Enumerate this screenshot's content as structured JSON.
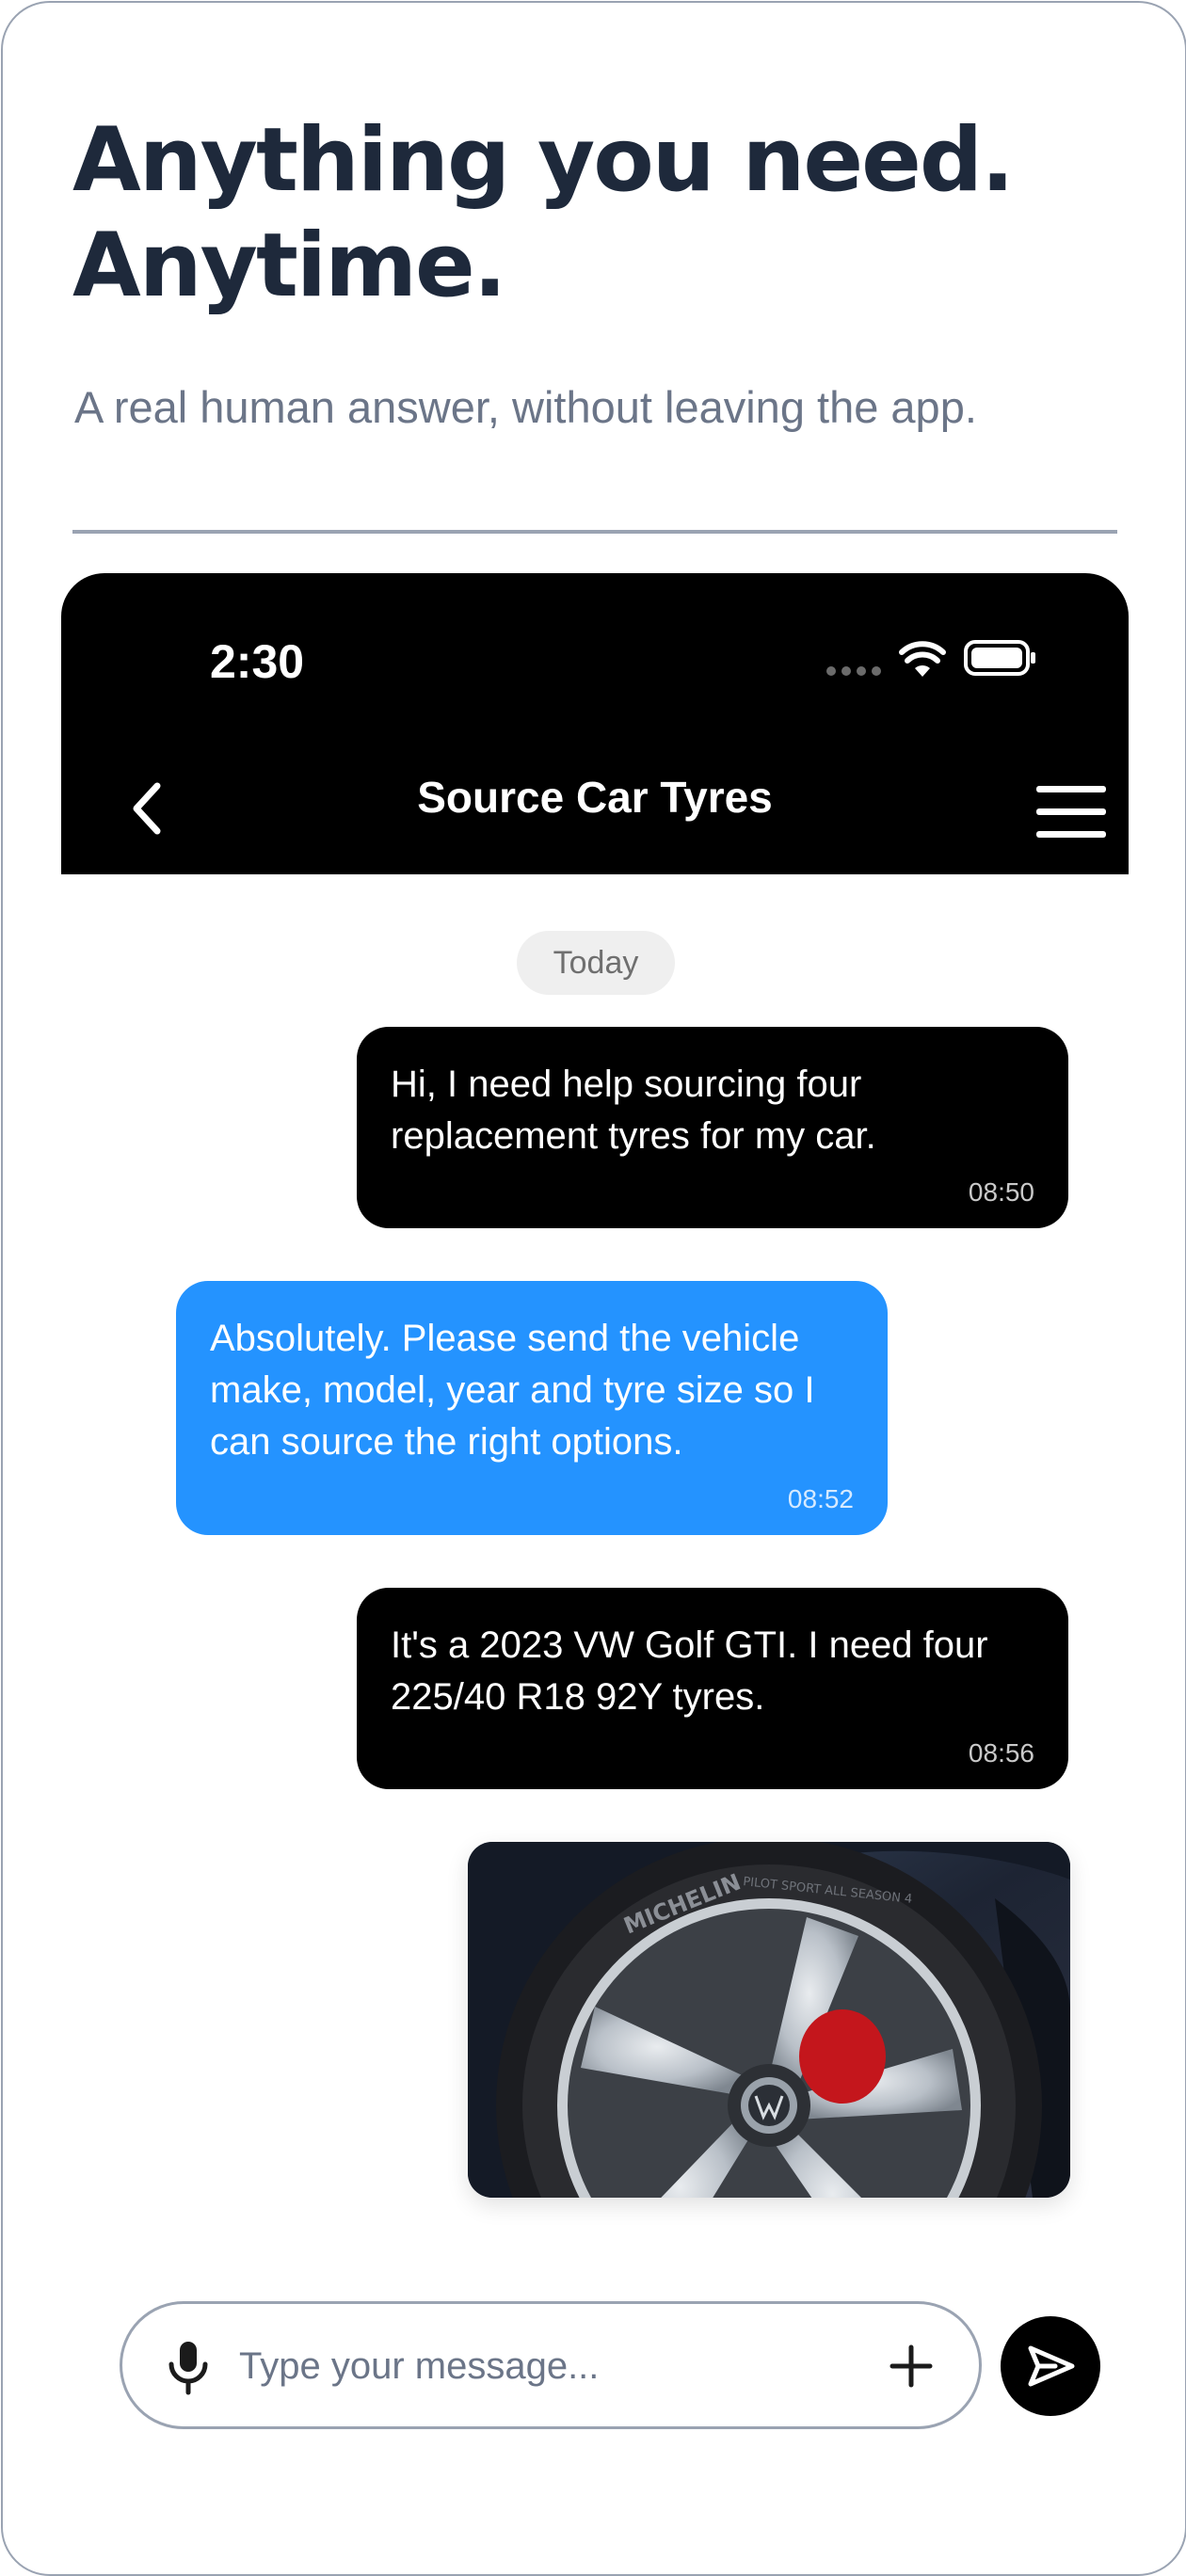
{
  "hero": {
    "title_line1": "Anything you need.",
    "title_line2": "Anytime.",
    "subtitle": "A real human answer, without leaving the app."
  },
  "status_bar": {
    "time": "2:30",
    "icons": [
      "signal-dots-icon",
      "wifi-icon",
      "battery-icon"
    ]
  },
  "chat_header": {
    "title": "Source Car Tyres",
    "back_icon": "chevron-left-icon",
    "menu_icon": "hamburger-menu-icon"
  },
  "date_separator": "Today",
  "messages": [
    {
      "sender": "user",
      "text": "Hi, I need help sourcing four replacement tyres for my car.",
      "time": "08:50"
    },
    {
      "sender": "agent",
      "text": "Absolutely. Please send the vehicle make, model, year and tyre size so I can source the right options.",
      "time": "08:52"
    },
    {
      "sender": "user",
      "text": "It's a 2023 VW Golf GTI. I need four 225/40 R18 92Y tyres.",
      "time": "08:56"
    },
    {
      "sender": "user",
      "type": "image",
      "image": "car-wheel-photo"
    }
  ],
  "photo": {
    "tyre_brand": "MICHELIN",
    "tyre_model": "PILOT SPORT ALL SEASON 4"
  },
  "composer": {
    "placeholder": "Type your message...",
    "mic_icon": "microphone-icon",
    "add_icon": "plus-icon",
    "send_icon": "send-icon"
  },
  "colors": {
    "heading": "#1e293b",
    "muted": "#6b7588",
    "border": "#9aa3b2",
    "header_bg": "#000000",
    "user_bubble": "#000000",
    "agent_bubble": "#2493ff",
    "pill_bg": "#efefef"
  }
}
